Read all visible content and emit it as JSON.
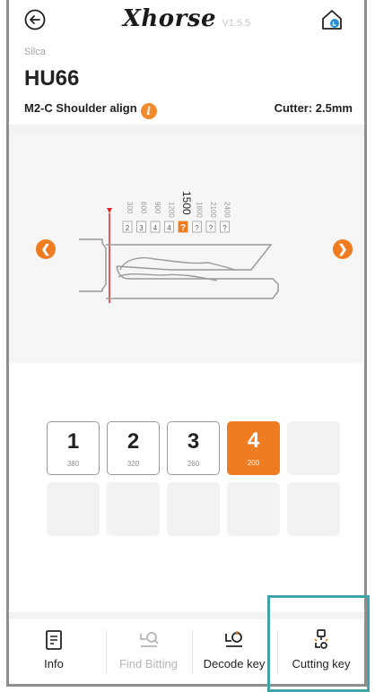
{
  "header": {
    "brand": "Xhorse",
    "version": "V1.5.5"
  },
  "key": {
    "manufacturer": "Silca",
    "model": "HU66",
    "series": "M2-C Shoulder align",
    "cutter": "Cutter: 2.5mm"
  },
  "diagram": {
    "depths": [
      "300",
      "600",
      "900",
      "1200",
      "1500",
      "1800",
      "2100",
      "2400"
    ],
    "values": [
      "2",
      "3",
      "4",
      "4",
      "?",
      "?",
      "?",
      "?"
    ],
    "active_index": 4
  },
  "codes": [
    {
      "num": "1",
      "sub": "380"
    },
    {
      "num": "2",
      "sub": "320"
    },
    {
      "num": "3",
      "sub": "260"
    },
    {
      "num": "4",
      "sub": "200"
    }
  ],
  "nav": {
    "info": "Info",
    "find_bitting": "Find Bitting",
    "decode_key": "Decode key",
    "cutting_key": "Cutting key"
  },
  "colors": {
    "accent": "#f07c22",
    "highlight": "#3fa3a7"
  },
  "icons": [
    "back-icon",
    "home-icon",
    "info-icon",
    "arrow-left-icon",
    "arrow-right-icon",
    "document-icon",
    "find-bitting-icon",
    "decode-key-icon",
    "cutting-key-icon"
  ]
}
